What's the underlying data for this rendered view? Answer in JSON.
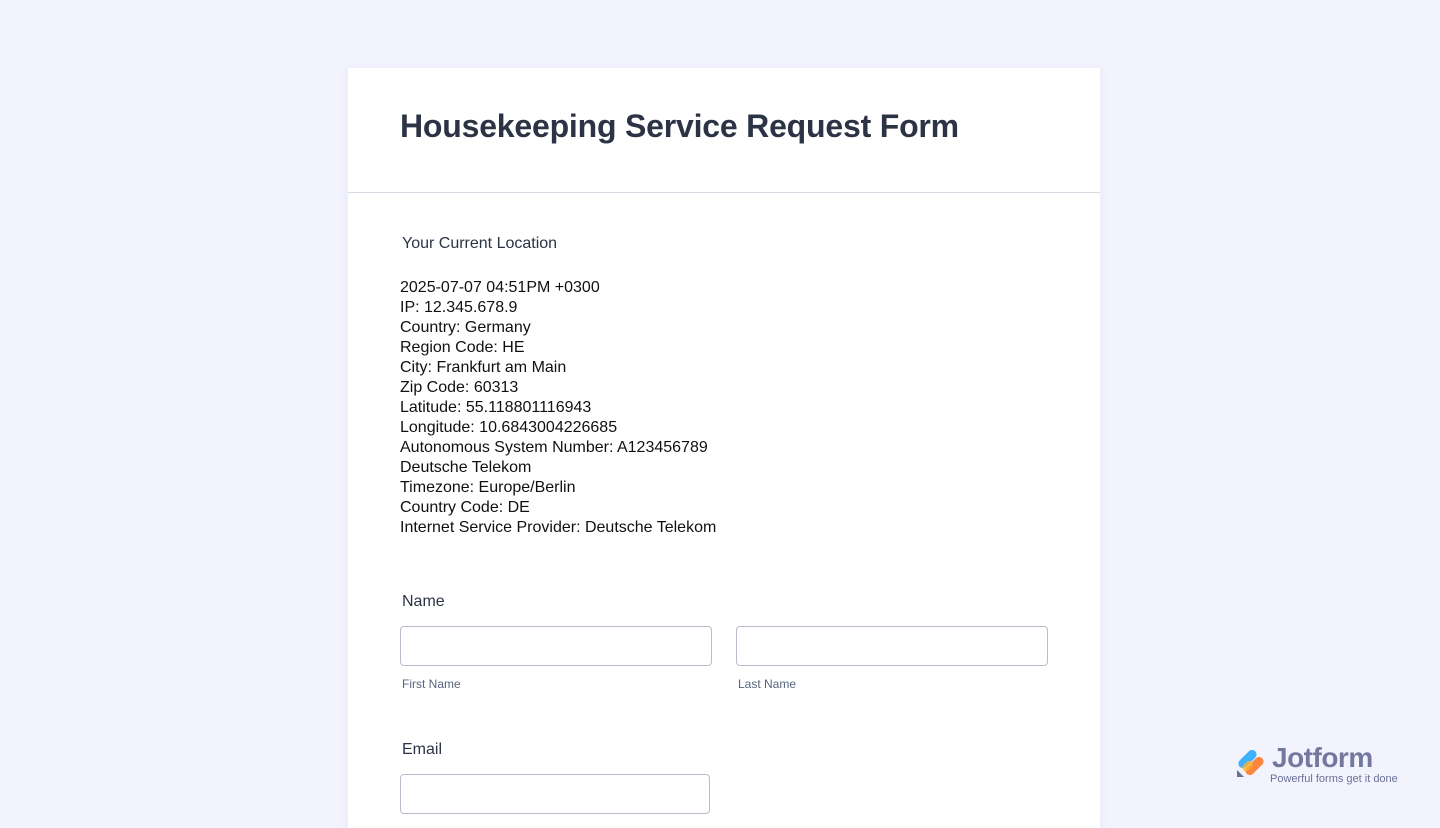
{
  "form": {
    "title": "Housekeeping Service Request Form"
  },
  "location": {
    "label": "Your Current Location",
    "lines": [
      "2025-07-07 04:51PM +0300",
      "IP: 12.345.678.9",
      "Country: Germany",
      "Region Code: HE",
      "City: Frankfurt am Main",
      "Zip Code: 60313",
      "Latitude: 55.118801116943",
      "Longitude: 10.6843004226685",
      "Autonomous System Number: A123456789",
      "Deutsche Telekom",
      "Timezone: Europe/Berlin",
      "Country Code: DE",
      "Internet Service Provider: Deutsche Telekom"
    ]
  },
  "name_field": {
    "label": "Name",
    "first_value": "",
    "first_sublabel": "First Name",
    "last_value": "",
    "last_sublabel": "Last Name"
  },
  "email_field": {
    "label": "Email",
    "value": ""
  },
  "branding": {
    "name": "Jotform",
    "tagline": "Powerful forms get it done",
    "icon": "jotform-logo-icon",
    "colors": [
      "#0099ff",
      "#ff6100",
      "#ffb629",
      "#0a1551"
    ]
  }
}
